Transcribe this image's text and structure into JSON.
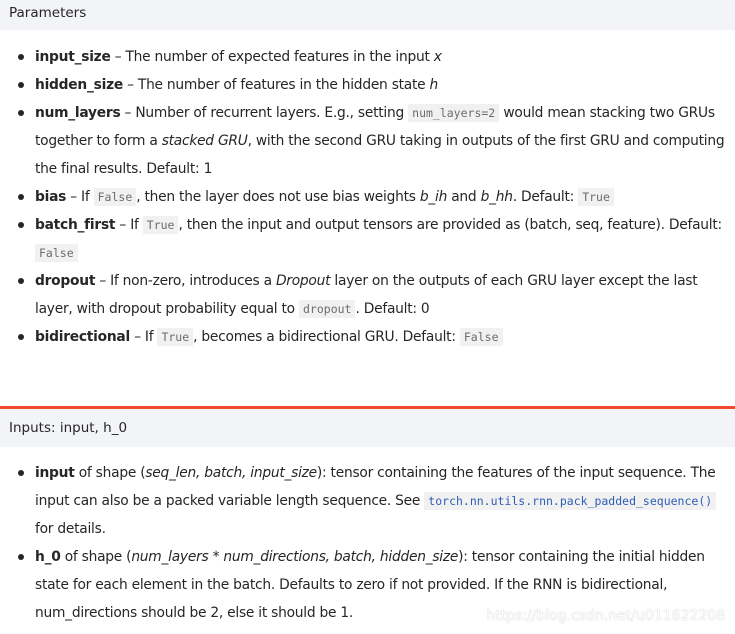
{
  "parameters": {
    "header": "Parameters",
    "items": [
      {
        "term": "input_size",
        "parts": [
          " – The number of expected features in the input ",
          "x"
        ]
      },
      {
        "term": "hidden_size",
        "parts": [
          " – The number of features in the hidden state ",
          "h"
        ]
      },
      {
        "term": "num_layers",
        "parts": [
          " – Number of recurrent layers. E.g., setting ",
          "num_layers=2",
          " would mean stacking two GRUs together to form a ",
          "stacked GRU",
          ", with the second GRU taking in outputs of the first GRU and computing the final results. Default: 1"
        ]
      },
      {
        "term": "bias",
        "parts": [
          " – If ",
          "False",
          ", then the layer does not use bias weights ",
          "b_ih",
          " and ",
          "b_hh",
          ". Default: ",
          "True"
        ]
      },
      {
        "term": "batch_first",
        "parts": [
          " – If ",
          "True",
          ", then the input and output tensors are provided as (batch, seq, feature). Default: ",
          "False"
        ]
      },
      {
        "term": "dropout",
        "parts": [
          " – If non-zero, introduces a ",
          "Dropout",
          " layer on the outputs of each GRU layer except the last layer, with dropout probability equal to ",
          "dropout",
          ". Default: 0"
        ]
      },
      {
        "term": "bidirectional",
        "parts": [
          " – If ",
          "True",
          ", becomes a bidirectional GRU. Default: ",
          "False"
        ]
      }
    ]
  },
  "inputs": {
    "header": "Inputs: input, h_0",
    "items": [
      {
        "term": "input",
        "parts": [
          " of shape (",
          "seq_len, batch, input_size",
          "): tensor containing the features of the input sequence. The input can also be a packed variable length sequence. See ",
          "torch.nn.utils.rnn.pack_padded_sequence()",
          " for details."
        ]
      },
      {
        "term": "h_0",
        "parts": [
          " of shape (",
          "num_layers * num_directions, batch, hidden_size",
          "): tensor containing the initial hidden state for each element in the batch. Defaults to zero if not provided. If the RNN is bidirectional, num_directions should be 2, else it should be 1."
        ]
      }
    ]
  },
  "watermark": "https://blog.csdn.net/u011622208",
  "colors": {
    "accent_divider": "#ee4c2c",
    "header_bg": "#f3f4f7",
    "link": "#2e5db5",
    "code_bg": "#f1f1f1"
  }
}
